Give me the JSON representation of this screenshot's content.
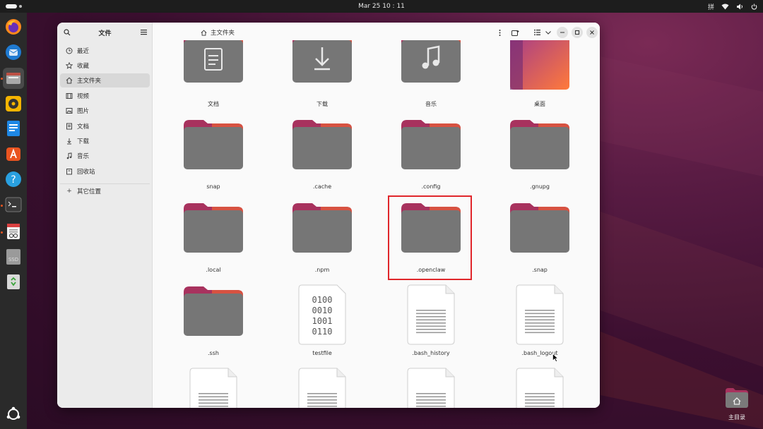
{
  "topbar": {
    "clock": "Mar 25  10 : 11",
    "input_method": "拼",
    "icons": [
      "network-icon",
      "volume-icon",
      "power-icon"
    ]
  },
  "dock": {
    "apps": [
      {
        "name": "firefox",
        "icon": "firefox-icon"
      },
      {
        "name": "thunderbird",
        "icon": "thunderbird-icon"
      },
      {
        "name": "files",
        "icon": "files-icon",
        "active": true
      },
      {
        "name": "rhythmbox",
        "icon": "rhythmbox-icon"
      },
      {
        "name": "libreoffice-writer",
        "icon": "writer-icon"
      },
      {
        "name": "app-center",
        "icon": "app-center-icon"
      },
      {
        "name": "help",
        "icon": "help-icon"
      },
      {
        "name": "terminal",
        "icon": "terminal-icon"
      },
      {
        "name": "document-viewer",
        "icon": "document-viewer-icon"
      },
      {
        "name": "ssd",
        "icon": "ssd-icon",
        "text": "SSD"
      },
      {
        "name": "trash",
        "icon": "trash-icon"
      },
      {
        "name": "show-apps",
        "icon": "ubuntu-icon"
      }
    ]
  },
  "sidebar": {
    "title": "文件",
    "items": [
      {
        "label": "最近",
        "icon": "clock-icon"
      },
      {
        "label": "收藏",
        "icon": "star-icon"
      },
      {
        "label": "主文件夹",
        "icon": "home-icon",
        "selected": true
      },
      {
        "label": "视频",
        "icon": "video-icon"
      },
      {
        "label": "图片",
        "icon": "image-icon"
      },
      {
        "label": "文档",
        "icon": "document-icon"
      },
      {
        "label": "下载",
        "icon": "download-icon"
      },
      {
        "label": "音乐",
        "icon": "music-icon"
      },
      {
        "label": "回收站",
        "icon": "trash-icon"
      }
    ],
    "other_locations": "其它位置"
  },
  "header": {
    "location": "主文件夹"
  },
  "files": [
    {
      "name": "文档",
      "type": "folder-documents"
    },
    {
      "name": "下载",
      "type": "folder-downloads"
    },
    {
      "name": "音乐",
      "type": "folder-music"
    },
    {
      "name": "桌面",
      "type": "folder-desktop"
    },
    {
      "name": "snap",
      "type": "folder"
    },
    {
      "name": ".cache",
      "type": "folder"
    },
    {
      "name": ".config",
      "type": "folder"
    },
    {
      "name": ".gnupg",
      "type": "folder"
    },
    {
      "name": ".local",
      "type": "folder"
    },
    {
      "name": ".npm",
      "type": "folder"
    },
    {
      "name": ".openclaw",
      "type": "folder",
      "highlighted": true
    },
    {
      "name": ".snap",
      "type": "folder"
    },
    {
      "name": ".ssh",
      "type": "folder"
    },
    {
      "name": "testfile",
      "type": "binary"
    },
    {
      "name": ".bash_history",
      "type": "text"
    },
    {
      "name": ".bash_logout",
      "type": "text"
    }
  ],
  "desktop": {
    "home_label": "主目录"
  },
  "colors": {
    "accent": "#e95420",
    "highlight_border": "#e0262b",
    "folder_body": "#767676",
    "folder_tab": "#a8325e"
  }
}
